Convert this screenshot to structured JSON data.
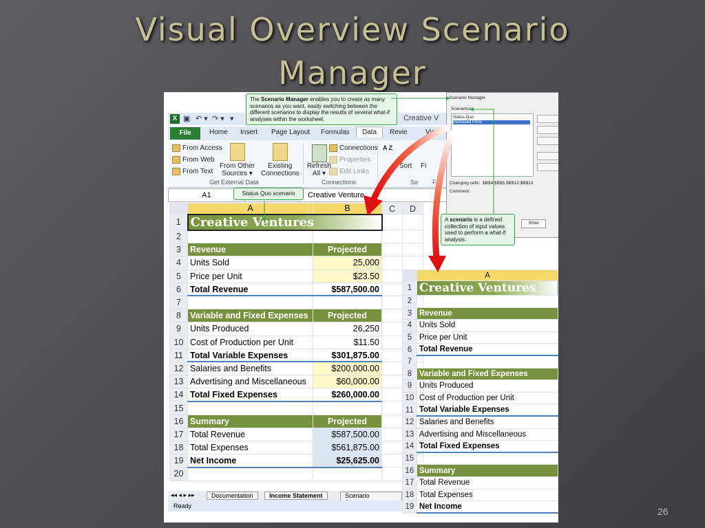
{
  "slide": {
    "title_line1": "Visual Overview Scenario",
    "title_line2": "Manager",
    "page_number": "26"
  },
  "excel": {
    "qat_icons": [
      "excel-icon",
      "save-icon",
      "undo-icon",
      "redo-icon"
    ],
    "tabs": [
      "File",
      "Home",
      "Insert",
      "Page Layout",
      "Formulas",
      "Data",
      "Revie",
      "View"
    ],
    "window_title": "Creative V",
    "ribbon": {
      "from_access": "From Access",
      "from_web": "From Web",
      "from_text": "From Text",
      "from_other_1": "From Other",
      "from_other_2": "Sources ▾",
      "existing_1": "Existing",
      "existing_2": "Connections",
      "refresh_1": "Refresh",
      "refresh_2": "All ▾",
      "connections": "Connections",
      "properties": "Properties",
      "edit_links": "Edit Links",
      "sort": "Sort",
      "filter": "Fi",
      "sortaz": "A Z",
      "group_get_external": "Get External Data",
      "group_connections": "Connections",
      "group_sort": "So",
      "group_filter": "Filt"
    },
    "namebox": "A1",
    "formula_value": "Creative Venture",
    "sheet_tabs": [
      "Documentation",
      "Income Statement",
      "Scenario Summary"
    ],
    "status": "Ready",
    "sheet1": {
      "cols": [
        "A",
        "B",
        "C",
        "D"
      ],
      "rows": [
        {
          "n": "1",
          "a": "Creative Ventures",
          "b": "",
          "type": "title"
        },
        {
          "n": "2",
          "a": "",
          "b": ""
        },
        {
          "n": "3",
          "a": "Revenue",
          "b": "Projected",
          "type": "hdr"
        },
        {
          "n": "4",
          "a": "Units Sold",
          "b": "25,000",
          "bstyle": "yel"
        },
        {
          "n": "5",
          "a": "Price per Unit",
          "b": "$23.50",
          "bstyle": "yel"
        },
        {
          "n": "6",
          "a": "Total Revenue",
          "b": "$587,500.00",
          "type": "tot"
        },
        {
          "n": "7",
          "a": "",
          "b": ""
        },
        {
          "n": "8",
          "a": "Variable and Fixed Expenses",
          "b": "Projected",
          "type": "hdr"
        },
        {
          "n": "9",
          "a": "Units Produced",
          "b": "26,250"
        },
        {
          "n": "10",
          "a": "Cost of Production per Unit",
          "b": "$11.50"
        },
        {
          "n": "11",
          "a": "Total Variable Expenses",
          "b": "$301,875.00",
          "type": "tot"
        },
        {
          "n": "12",
          "a": "Salaries and Benefits",
          "b": "$200,000.00",
          "bstyle": "yel"
        },
        {
          "n": "13",
          "a": "Advertising and Miscellaneous",
          "b": "$60,000.00",
          "bstyle": "yel"
        },
        {
          "n": "14",
          "a": "Total Fixed Expenses",
          "b": "$260,000.00",
          "type": "tot"
        },
        {
          "n": "15",
          "a": "",
          "b": ""
        },
        {
          "n": "16",
          "a": "Summary",
          "b": "Projected",
          "type": "hdr"
        },
        {
          "n": "17",
          "a": "Total Revenue",
          "b": "$587,500.00",
          "bstyle": "blu"
        },
        {
          "n": "18",
          "a": "Total Expenses",
          "b": "$561,875.00",
          "bstyle": "blu"
        },
        {
          "n": "19",
          "a": "Net Income",
          "b": "$25,625.00",
          "type": "tot",
          "bstyle": "blu"
        },
        {
          "n": "20",
          "a": "",
          "b": ""
        }
      ]
    },
    "sheet2": {
      "cols": [
        "A"
      ],
      "rows": [
        {
          "n": "1",
          "a": "Creative Ventures",
          "type": "title"
        },
        {
          "n": "2",
          "a": ""
        },
        {
          "n": "3",
          "a": "Revenue",
          "type": "hdr"
        },
        {
          "n": "4",
          "a": "Units Sold"
        },
        {
          "n": "5",
          "a": "Price per Unit"
        },
        {
          "n": "6",
          "a": "Total Revenue",
          "type": "tot"
        },
        {
          "n": "7",
          "a": ""
        },
        {
          "n": "8",
          "a": "Variable and Fixed Expenses",
          "type": "hdr"
        },
        {
          "n": "9",
          "a": "Units Produced"
        },
        {
          "n": "10",
          "a": "Cost of Production per Unit"
        },
        {
          "n": "11",
          "a": "Total Variable Expenses",
          "type": "tot"
        },
        {
          "n": "12",
          "a": "Salaries and Benefits"
        },
        {
          "n": "13",
          "a": "Advertising and Miscellaneous"
        },
        {
          "n": "14",
          "a": "Total Fixed Expenses",
          "type": "tot"
        },
        {
          "n": "15",
          "a": ""
        },
        {
          "n": "16",
          "a": "Summary",
          "type": "hdr"
        },
        {
          "n": "17",
          "a": "Total Revenue"
        },
        {
          "n": "18",
          "a": "Total Expenses"
        },
        {
          "n": "19",
          "a": "Net Income",
          "type": "tot"
        }
      ]
    }
  },
  "dialog": {
    "title": "Scenario Manager",
    "scenarios_label": "Scenarios:",
    "items": [
      "Status Quo",
      "Increased Price"
    ],
    "selected_index": 1,
    "changing_cells_label": "Changing cells:",
    "changing_cells_value": "$B$4,$B$5,$B$12:$B$13",
    "comment_label": "Comment:",
    "show_button": "Show"
  },
  "callouts": {
    "manager_prefix": "The ",
    "manager_bold": "Scenario Manager",
    "manager_text": " enables you to create as many scenarios as you want, easily switching between the different scenarios to display the results of several what-if analyses within the worksheet.",
    "status_quo": "Status Quo scenario",
    "scenario_prefix": "A ",
    "scenario_bold": "scenario",
    "scenario_text": " is a defined collection of input values used to perform a what-if analysis."
  }
}
